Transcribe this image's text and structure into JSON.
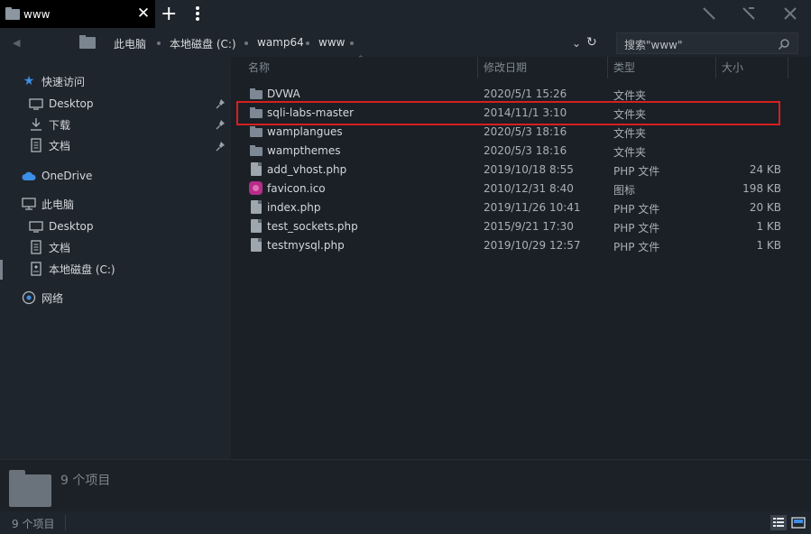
{
  "window": {
    "tab_title": "www",
    "tab_close": "✕",
    "new_tab": "+"
  },
  "address": {
    "back": "◀",
    "breadcrumbs": [
      "此电脑",
      "本地磁盘 (C:)",
      "wamp64",
      "www"
    ],
    "dropdown": "⌄",
    "refresh": "↻",
    "search_placeholder": "搜索\"www\""
  },
  "sidebar": {
    "quick_access": "快速访问",
    "quick_items": [
      "Desktop",
      "下载",
      "文档"
    ],
    "onedrive": "OneDrive",
    "this_pc": "此电脑",
    "pc_items": [
      "Desktop",
      "文档",
      "本地磁盘 (C:)"
    ],
    "network": "网络"
  },
  "columns": {
    "name": "名称",
    "date": "修改日期",
    "type": "类型",
    "size": "大小"
  },
  "files": [
    {
      "name": "DVWA",
      "date": "2020/5/1 15:26",
      "type": "文件夹",
      "size": "",
      "icon": "folder"
    },
    {
      "name": "sqli-labs-master",
      "date": "2014/11/1 3:10",
      "type": "文件夹",
      "size": "",
      "icon": "folder"
    },
    {
      "name": "wamplangues",
      "date": "2020/5/3 18:16",
      "type": "文件夹",
      "size": "",
      "icon": "folder"
    },
    {
      "name": "wampthemes",
      "date": "2020/5/3 18:16",
      "type": "文件夹",
      "size": "",
      "icon": "folder"
    },
    {
      "name": "add_vhost.php",
      "date": "2019/10/18 8:55",
      "type": "PHP 文件",
      "size": "24 KB",
      "icon": "document"
    },
    {
      "name": "favicon.ico",
      "date": "2010/12/31 8:40",
      "type": "图标",
      "size": "198 KB",
      "icon": "image"
    },
    {
      "name": "index.php",
      "date": "2019/11/26 10:41",
      "type": "PHP 文件",
      "size": "20 KB",
      "icon": "document"
    },
    {
      "name": "test_sockets.php",
      "date": "2015/9/21 17:30",
      "type": "PHP 文件",
      "size": "1 KB",
      "icon": "document"
    },
    {
      "name": "testmysql.php",
      "date": "2019/10/29 12:57",
      "type": "PHP 文件",
      "size": "1 KB",
      "icon": "document"
    }
  ],
  "details": {
    "count_label": "9 个项目"
  },
  "status": {
    "count_label": "9 个项目"
  },
  "colors": {
    "highlight": "#d42020",
    "accent_blue": "#3d8ee6"
  }
}
